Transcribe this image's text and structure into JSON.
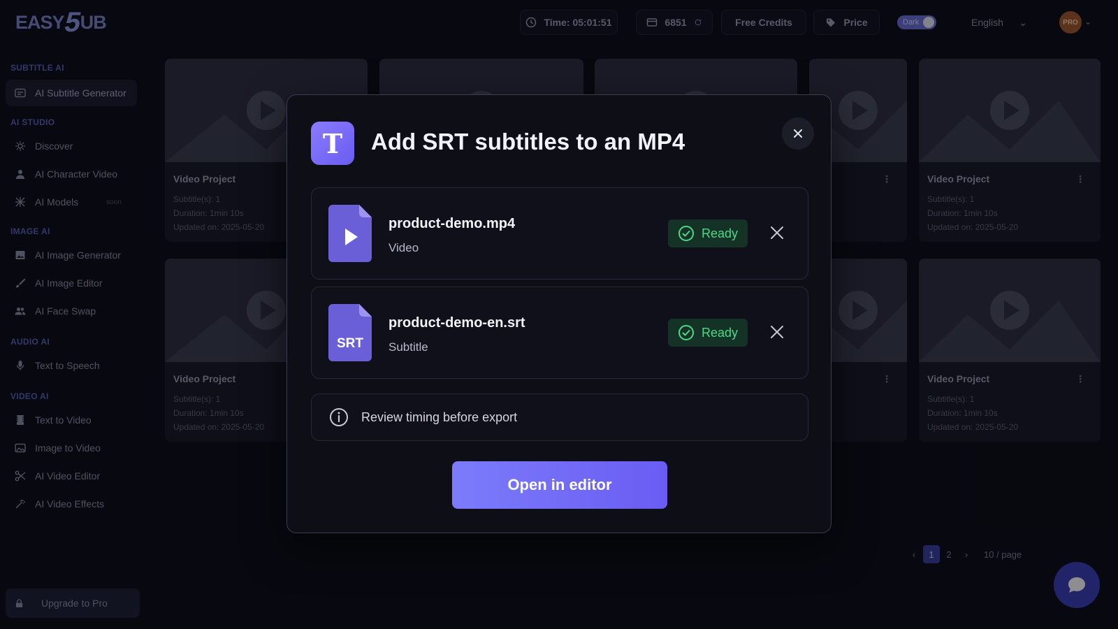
{
  "app": {
    "logo_text_a": "EASY",
    "logo_text_b": "5",
    "logo_text_c": "UB"
  },
  "topbar": {
    "time_label": "Time: 05:01:51",
    "credits_value": "6851",
    "free_credits_label": "Free Credits",
    "price_label": "Price",
    "theme_toggle_label": "Dark",
    "language": "English",
    "avatar_badge": "PRO"
  },
  "sidebar": {
    "sections": [
      {
        "title": "SUBTITLE AI",
        "items": [
          {
            "label": "AI Subtitle Generator",
            "icon": "subtitle-icon",
            "active": true
          }
        ]
      },
      {
        "title": "AI STUDIO",
        "items": [
          {
            "label": "Discover",
            "icon": "discover-icon"
          },
          {
            "label": "AI Character Video",
            "icon": "person-icon"
          },
          {
            "label": "AI Models",
            "icon": "models-icon",
            "badge": "soon"
          }
        ]
      },
      {
        "title": "IMAGE AI",
        "items": [
          {
            "label": "AI Image Generator",
            "icon": "image-icon"
          },
          {
            "label": "AI Image Editor",
            "icon": "brush-icon"
          },
          {
            "label": "AI Face Swap",
            "icon": "users-icon"
          }
        ]
      },
      {
        "title": "AUDIO AI",
        "items": [
          {
            "label": "Text to Speech",
            "icon": "microphone-icon"
          }
        ]
      },
      {
        "title": "VIDEO AI",
        "items": [
          {
            "label": "Text to Video",
            "icon": "film-icon"
          },
          {
            "label": "Image to Video",
            "icon": "image-video-icon"
          },
          {
            "label": "AI Video Editor",
            "icon": "scissors-icon"
          },
          {
            "label": "AI Video Effects",
            "icon": "wand-icon"
          }
        ]
      }
    ],
    "upgrade_label": "Upgrade to Pro"
  },
  "projects": {
    "card_title": "Video Project",
    "subtitles": "Subtitle(s): 1",
    "duration": "Duration: 1min 10s",
    "updated": "Updated on: 2025-05-20"
  },
  "pagination": {
    "pages": [
      "1",
      "2"
    ],
    "current": "1",
    "page_size": "10 / page"
  },
  "modal": {
    "logo_letter": "T",
    "title": "Add SRT subtitles to an MP4",
    "files": [
      {
        "name": "product-demo.mp4",
        "type": "Video",
        "status": "Ready",
        "icon": "video-file-icon"
      },
      {
        "name": "product-demo-en.srt",
        "type": "Subtitle",
        "status": "Ready",
        "icon": "srt-file-icon",
        "icon_label": "SRT"
      }
    ],
    "note": "Review timing before export",
    "primary_button": "Open in editor"
  },
  "colors": {
    "accent": "#7c7cfb",
    "ready_text": "#4fd78a",
    "ready_bg": "#143326",
    "background": "#0c0d14"
  }
}
